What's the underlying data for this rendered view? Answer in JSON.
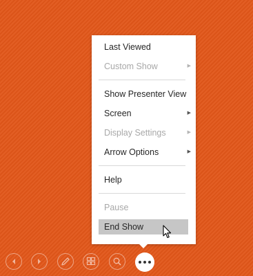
{
  "menu": {
    "items": [
      {
        "label": "Last Viewed",
        "disabled": false,
        "submenu": false
      },
      {
        "label": "Custom Show",
        "disabled": true,
        "submenu": true
      },
      {
        "label": "Show Presenter View",
        "disabled": false,
        "submenu": false
      },
      {
        "label": "Screen",
        "disabled": false,
        "submenu": true
      },
      {
        "label": "Display Settings",
        "disabled": true,
        "submenu": true
      },
      {
        "label": "Arrow Options",
        "disabled": false,
        "submenu": true
      },
      {
        "label": "Help",
        "disabled": false,
        "submenu": false
      },
      {
        "label": "Pause",
        "disabled": true,
        "submenu": false
      },
      {
        "label": "End Show",
        "disabled": false,
        "submenu": false,
        "hovered": true
      }
    ],
    "submenu_arrow": "▶"
  },
  "toolbar": {
    "buttons": [
      {
        "icon": "previous-icon"
      },
      {
        "icon": "next-icon"
      },
      {
        "icon": "pen-icon"
      },
      {
        "icon": "see-all-slides-icon"
      },
      {
        "icon": "zoom-icon"
      },
      {
        "icon": "more-options-icon"
      }
    ]
  },
  "colors": {
    "background": "#e2571a",
    "menu_background": "#ffffff",
    "hover": "#c6c6c6",
    "text": "#262626",
    "disabled_text": "#a8a8a8"
  }
}
